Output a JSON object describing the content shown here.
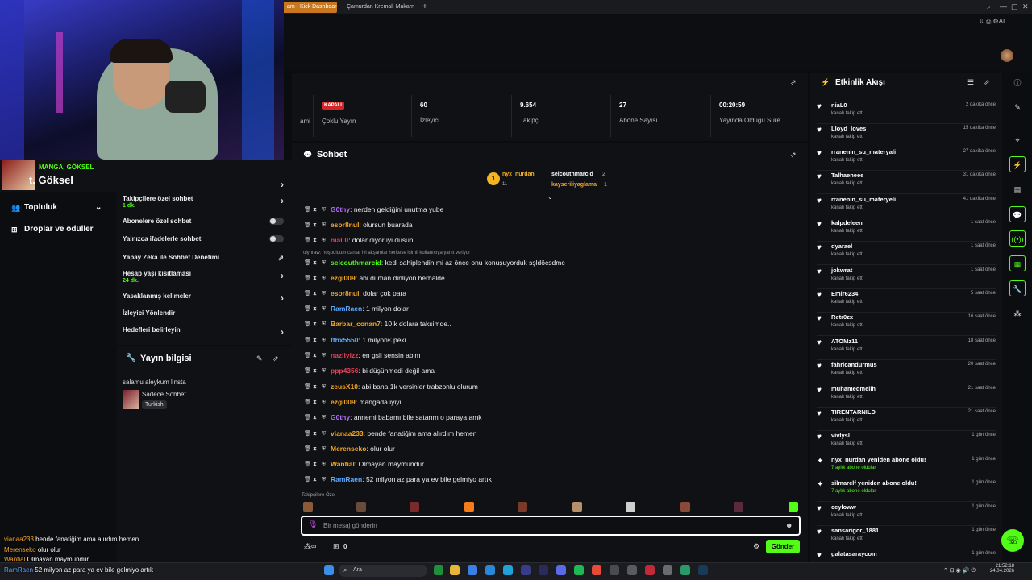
{
  "tabs": [
    {
      "label": "am - Kick Dashboard"
    },
    {
      "label": "Çamurdan Kremalı Makarn"
    }
  ],
  "webcam": {
    "category": "MANGA, GÖKSEL",
    "name": "t. Göksel"
  },
  "nav": [
    {
      "label": "Topluluk"
    },
    {
      "label": "Droplar ve ödüller"
    }
  ],
  "settings": [
    {
      "label": "Takipçilere özel sohbet",
      "sub": "1 dk."
    },
    {
      "label": "Abonelere özel sohbet",
      "sub": ""
    },
    {
      "label": "Yalnızca ifadelerle sohbet",
      "sub": ""
    },
    {
      "label": "Yapay Zeka ile Sohbet Denetimi",
      "sub": ""
    },
    {
      "label": "Hesap yaşı kısıtlaması",
      "sub": "24 dk."
    },
    {
      "label": "Yasaklanmış kelimeler",
      "sub": ""
    },
    {
      "label": "İzleyici Yönlendir",
      "sub": ""
    },
    {
      "label": "Hedefleri belirleyin",
      "sub": ""
    }
  ],
  "stream_info": {
    "title": "Yayın bilgisi",
    "text": "salamu aleykum linsta",
    "category": "Sadece Sohbet",
    "language": "Turkish"
  },
  "stats": [
    {
      "label": "Çoklu Yayın",
      "value": "KAPALI",
      "prefix": "ami"
    },
    {
      "label": "İzleyici",
      "value": "60"
    },
    {
      "label": "Takipçi",
      "value": "9.654"
    },
    {
      "label": "Abone Sayısı",
      "value": "27"
    },
    {
      "label": "Yayında Olduğu Süre",
      "value": "00:20:59"
    }
  ],
  "chat": {
    "title": "Sohbet",
    "top": [
      {
        "name": "nyx_nurdan",
        "count": "11"
      },
      {
        "name": "selcouthmarcid",
        "count": "2"
      },
      {
        "name": "kayseriliyaglama",
        "count": "1"
      }
    ],
    "pinned": "rolynraw: hoşbuldum canlar iyi akşamlar herkese isimli kullanıcıya yanıt veriyor",
    "messages": [
      {
        "user": "G0thy",
        "text": ": nerden geldiğini unutma yube",
        "color": "#b46dff"
      },
      {
        "user": "esor8nul",
        "text": ": olursun buarada",
        "color": "#f5a623"
      },
      {
        "user": "niaL0",
        "text": ": dolar diyor iyi dusun",
        "color": "#e0405a"
      },
      {
        "user": "selcouthmarcid",
        "text": ": kedi sahiplendin mi az önce onu konuşuyorduk sşldöcsdmc",
        "color": "#53fc18"
      },
      {
        "user": "ezgi009",
        "text": ": abi duman dinliyon herhalde",
        "color": "#f5a623"
      },
      {
        "user": "esor8nul",
        "text": ": dolar çok para",
        "color": "#f5a623"
      },
      {
        "user": "RamRaen",
        "text": ": 1 milyon dolar",
        "color": "#5fa8ff"
      },
      {
        "user": "Barbar_conan7",
        "text": ": 10 k dolara taksimde..",
        "color": "#f5a623"
      },
      {
        "user": "fthx5550",
        "text": ": 1 milyon€ peki",
        "color": "#5fa8ff"
      },
      {
        "user": "nazliyizz",
        "text": ": en gsli sensin abim",
        "color": "#e0405a"
      },
      {
        "user": "ppp4356",
        "text": ": bi düşünmedi değil ama",
        "color": "#e0405a"
      },
      {
        "user": "zeusX10",
        "text": ": abi bana 1k versinler trabzonlu olurum",
        "color": "#f5a623"
      },
      {
        "user": "ezgi009",
        "text": ": mangada iyiyi",
        "color": "#f5a623"
      },
      {
        "user": "G0thy",
        "text": ": annemi babamı bile satarım o paraya amk",
        "color": "#b46dff"
      },
      {
        "user": "vianaa233",
        "text": ": bende fanatiğim ama alırdım hemen",
        "color": "#f5a623"
      },
      {
        "user": "Merenseko",
        "text": ": olur olur",
        "color": "#f5a623"
      },
      {
        "user": "Wantial",
        "text": ": Olmayan maymundur",
        "color": "#f5a623"
      },
      {
        "user": "RamRaen",
        "text": ": 52 milyon az para ya ev bile gelmiyo artık",
        "color": "#5fa8ff"
      }
    ],
    "followers_label": "Takipçilere Özel",
    "input_placeholder": "Bir mesaj gönderin",
    "send": "Gönder",
    "count": "0"
  },
  "activity": {
    "title": "Etkinlik Akışı",
    "items": [
      {
        "name": "niaL0",
        "sub": "kanalı takip etti",
        "time": "2 dakika önce"
      },
      {
        "name": "Lloyd_loves",
        "sub": "kanalı takip etti",
        "time": "15 dakika önce"
      },
      {
        "name": "rranenin_su_materyali",
        "sub": "kanalı takip etti",
        "time": "27 dakika önce"
      },
      {
        "name": "Talhaeneee",
        "sub": "kanalı takip etti",
        "time": "31 dakika önce"
      },
      {
        "name": "rranenin_su_materyeli",
        "sub": "kanalı takip etti",
        "time": "41 dakika önce"
      },
      {
        "name": "kalpdeleen",
        "sub": "kanalı takip etti",
        "time": "1 saat önce"
      },
      {
        "name": "dyarael",
        "sub": "kanalı takip etti",
        "time": "1 saat önce"
      },
      {
        "name": "jokwrat",
        "sub": "kanalı takip etti",
        "time": "1 saat önce"
      },
      {
        "name": "Emir6234",
        "sub": "kanalı takip etti",
        "time": "5 saat önce"
      },
      {
        "name": "Retr0zx",
        "sub": "kanalı takip etti",
        "time": "16 saat önce"
      },
      {
        "name": "ATOMz11",
        "sub": "kanalı takip etti",
        "time": "18 saat önce"
      },
      {
        "name": "fahricandurmus",
        "sub": "kanalı takip etti",
        "time": "20 saat önce"
      },
      {
        "name": "muhamedmelih",
        "sub": "kanalı takip etti",
        "time": "21 saat önce"
      },
      {
        "name": "TIRENTARNILD",
        "sub": "kanalı takip etti",
        "time": "21 saat önce"
      },
      {
        "name": "vivlysl",
        "sub": "kanalı takip etti",
        "time": "1 gün önce"
      },
      {
        "name": "nyx_nurdan yeniden abone oldu!",
        "sub": "7 aylık abone oldular",
        "time": "1 gün önce"
      },
      {
        "name": "silmarelf yeniden abone oldu!",
        "sub": "7 aylık abone oldular",
        "time": "1 gün önce"
      },
      {
        "name": "ceyloww",
        "sub": "kanalı takip etti",
        "time": "1 gün önce"
      },
      {
        "name": "sansarigor_1881",
        "sub": "kanalı takip etti",
        "time": "1 gün önce"
      },
      {
        "name": "galatasaraycom",
        "sub": "",
        "time": "1 gün önce"
      }
    ]
  },
  "overlay": [
    {
      "user": "vianaa233",
      "text": "bende fanatiğim ama alırdım hemen",
      "color": "#f5a623"
    },
    {
      "user": "Merenseko",
      "text": "olur olur",
      "color": "#f5a623"
    },
    {
      "user": "Wantial",
      "text": "Olmayan maymundur",
      "color": "#f5a623"
    },
    {
      "user": "RamRaen",
      "text": "52 milyon az para ya ev bile gelmiyo artık",
      "color": "#5fa8ff"
    }
  ],
  "taskbar": {
    "search": "Ara",
    "time": "21:52:18",
    "date": "24.04.2026"
  }
}
